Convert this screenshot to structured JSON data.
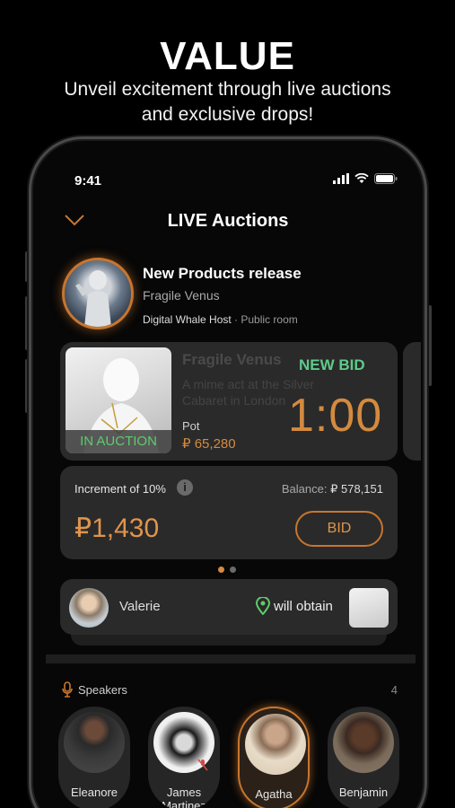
{
  "promo": {
    "title": "VALUE",
    "subtitle_line1": "Unveil excitement through live auctions",
    "subtitle_line2": "and exclusive drops!"
  },
  "status_bar": {
    "time": "9:41"
  },
  "nav": {
    "title": "LIVE Auctions",
    "back_icon": "chevron-down-icon"
  },
  "room": {
    "title": "New Products release",
    "subtitle": "Fragile Venus",
    "host": "Digital Whale Host",
    "separator": " · ",
    "visibility": "Public room"
  },
  "auction": {
    "badge": "IN AUCTION",
    "item_title": "Fragile Venus",
    "item_desc": "A mime act at the Silver Cabaret in London",
    "new_bid_label": "NEW BID",
    "timer": "1:00",
    "pot_label": "Pot",
    "pot_value": "65,280",
    "currency_symbol": "₽"
  },
  "bid": {
    "increment_label": "Increment of 10%",
    "balance_label": "Balance:",
    "balance_value": "578,151",
    "amount": "1,430",
    "button_label": "BID"
  },
  "pager": {
    "total": 2,
    "current": 1
  },
  "winner": {
    "name": "Valerie",
    "label": "will obtain"
  },
  "speakers": {
    "heading": "Speakers",
    "count": "4",
    "items": [
      {
        "name": "Eleanore",
        "active": false,
        "muted": false
      },
      {
        "name": "James Martinez",
        "active": false,
        "muted": true
      },
      {
        "name": "Agatha",
        "active": true,
        "muted": false
      },
      {
        "name": "Benjamin",
        "active": false,
        "muted": false
      }
    ]
  },
  "colors": {
    "accent": "#d48a3f",
    "success": "#5fcb6c",
    "card": "#2a2a2a",
    "background": "#000000"
  }
}
